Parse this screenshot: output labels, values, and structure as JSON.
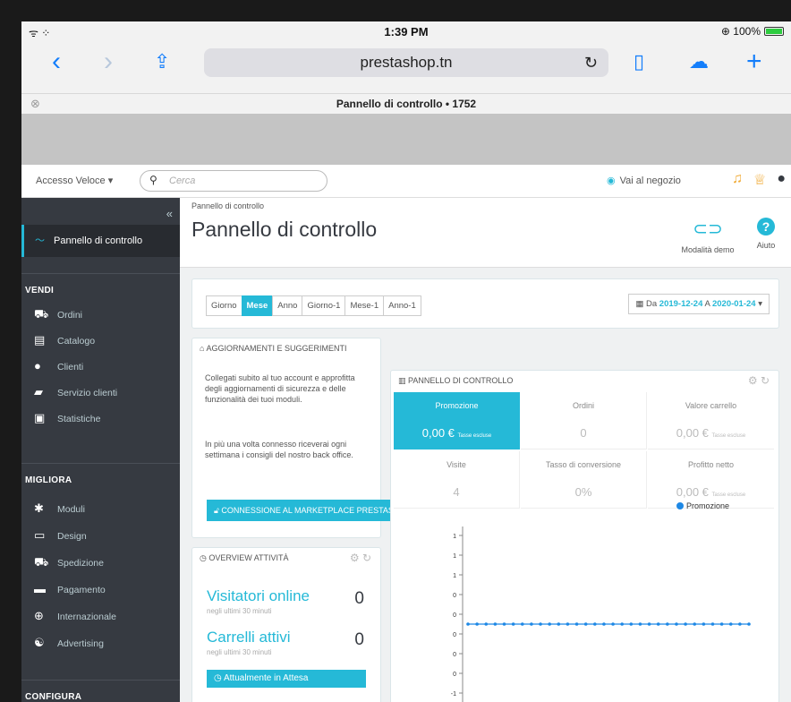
{
  "statusbar": {
    "signal": "ᯤ ⁘",
    "time": "1:39 PM",
    "battery_text": "⊕ 100%"
  },
  "browser": {
    "url": "prestashop.tn",
    "tab_title": "Pannello di controllo • 1752",
    "icons": [
      "back-icon",
      "forward-icon",
      "share-icon",
      "reload-icon",
      "bookmarks-icon",
      "cloud-icon",
      "new-tab-icon"
    ]
  },
  "header": {
    "quick_access": "Accesso Veloce ▾",
    "search_placeholder": "Cerca",
    "view_shop": "Vai al negozio"
  },
  "sidebar": {
    "collapse": "«",
    "active": "Pannello di controllo",
    "sections": [
      {
        "title": "VENDI",
        "items": [
          "Ordini",
          "Catalogo",
          "Clienti",
          "Servizio clienti",
          "Statistiche"
        ]
      },
      {
        "title": "MIGLIORA",
        "items": [
          "Moduli",
          "Design",
          "Spedizione",
          "Pagamento",
          "Internazionale",
          "Advertising"
        ]
      },
      {
        "title": "CONFIGURA",
        "items": []
      }
    ]
  },
  "page": {
    "breadcrumb": "Pannello di controllo",
    "title": "Pannello di controllo",
    "demo_label": "Modalità demo",
    "help_label": "Aiuto"
  },
  "filters": {
    "periods": [
      "Giorno",
      "Mese",
      "Anno",
      "Giorno-1",
      "Mese-1",
      "Anno-1"
    ],
    "active_period": "Mese",
    "date_prefix": "Da",
    "date_from": "2019-12-24",
    "date_sep": "A",
    "date_to": "2020-01-24"
  },
  "updates": {
    "title": "AGGIORNAMENTI E SUGGERIMENTI",
    "text1": "Collegati subito al tuo account e approfitta degli aggiornamenti di sicurezza e delle funzionalità dei tuoi moduli.",
    "text2": "In più una volta connesso riceverai ogni settimana i consigli del nostro back office.",
    "button": "CONNESSIONE AL MARKETPLACE PRESTASHOP"
  },
  "overview": {
    "title": "OVERVIEW ATTIVITÀ",
    "visitors_label": "Visitatori online",
    "visitors_sub": "negli ultimi 30 minuti",
    "visitors_value": "0",
    "carts_label": "Carrelli attivi",
    "carts_sub": "negli ultimi 30 minuti",
    "carts_value": "0",
    "pending": "Attualmente in Attesa"
  },
  "dashboard": {
    "title": "PANNELLO DI CONTROLLO",
    "kpis": [
      {
        "label": "Promozione",
        "value": "0,00 €",
        "note": "Tasse escluse"
      },
      {
        "label": "Ordini",
        "value": "0",
        "note": ""
      },
      {
        "label": "Valore carrello",
        "value": "0,00 €",
        "note": "Tasse escluse"
      },
      {
        "label": "Visite",
        "value": "4",
        "note": ""
      },
      {
        "label": "Tasso di conversione",
        "value": "0%",
        "note": ""
      },
      {
        "label": "Profitto netto",
        "value": "0,00 €",
        "note": "Tasse escluse"
      }
    ]
  },
  "chart_data": {
    "type": "line",
    "series": [
      {
        "name": "Promozione",
        "values": [
          0,
          0,
          0,
          0,
          0,
          0,
          0,
          0,
          0,
          0,
          0,
          0,
          0,
          0,
          0,
          0,
          0,
          0,
          0,
          0,
          0,
          0,
          0,
          0,
          0,
          0,
          0,
          0,
          0,
          0,
          0,
          0
        ]
      }
    ],
    "yticks": [
      "1",
      "1",
      "1",
      "0",
      "0",
      "0",
      "0",
      "0",
      "-1"
    ],
    "color": "#1e88e5"
  }
}
